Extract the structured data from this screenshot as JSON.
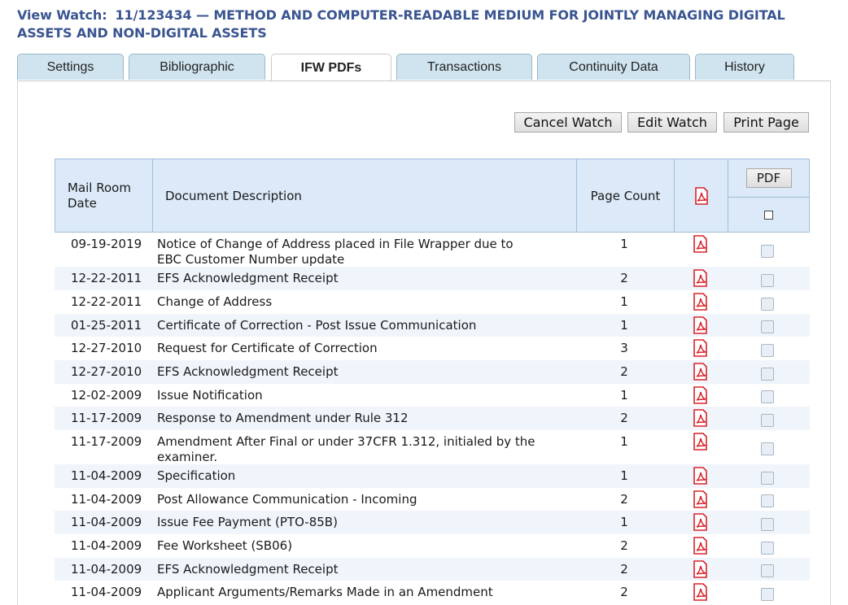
{
  "header": {
    "label": "View Watch:",
    "title": "11/123434 — METHOD AND COMPUTER-READABLE MEDIUM FOR JOINTLY MANAGING DIGITAL ASSETS AND NON-DIGITAL ASSETS"
  },
  "tabs": [
    {
      "label": "Settings"
    },
    {
      "label": "Bibliographic"
    },
    {
      "label": "IFW PDFs",
      "active": true
    },
    {
      "label": "Transactions"
    },
    {
      "label": "Continuity Data"
    },
    {
      "label": "History"
    }
  ],
  "actions": {
    "cancel": "Cancel Watch",
    "edit": "Edit Watch",
    "print": "Print Page"
  },
  "table": {
    "headers": {
      "date": "Mail Room Date",
      "description": "Document Description",
      "page_count": "Page Count",
      "pdf_button": "PDF"
    },
    "rows": [
      {
        "date": "09-19-2019",
        "description": "Notice of Change of Address placed in File Wrapper due to EBC Customer Number update",
        "pages": "1"
      },
      {
        "date": "12-22-2011",
        "description": "EFS Acknowledgment Receipt",
        "pages": "2"
      },
      {
        "date": "12-22-2011",
        "description": "Change of Address",
        "pages": "1"
      },
      {
        "date": "01-25-2011",
        "description": "Certificate of Correction - Post Issue Communication",
        "pages": "1"
      },
      {
        "date": "12-27-2010",
        "description": "Request for Certificate of Correction",
        "pages": "3"
      },
      {
        "date": "12-27-2010",
        "description": "EFS Acknowledgment Receipt",
        "pages": "2"
      },
      {
        "date": "12-02-2009",
        "description": "Issue Notification",
        "pages": "1"
      },
      {
        "date": "11-17-2009",
        "description": "Response to Amendment under Rule 312",
        "pages": "2"
      },
      {
        "date": "11-17-2009",
        "description": "Amendment After Final or under 37CFR 1.312, initialed by the examiner.",
        "pages": "1"
      },
      {
        "date": "11-04-2009",
        "description": "Specification",
        "pages": "1"
      },
      {
        "date": "11-04-2009",
        "description": "Post Allowance Communication - Incoming",
        "pages": "2"
      },
      {
        "date": "11-04-2009",
        "description": "Issue Fee Payment (PTO-85B)",
        "pages": "1"
      },
      {
        "date": "11-04-2009",
        "description": "Fee Worksheet (SB06)",
        "pages": "2"
      },
      {
        "date": "11-04-2009",
        "description": "EFS Acknowledgment Receipt",
        "pages": "2"
      },
      {
        "date": "11-04-2009",
        "description": "Applicant Arguments/Remarks Made in an Amendment",
        "pages": "2"
      }
    ]
  },
  "colors": {
    "title": "#3a5590",
    "tab_bg": "#cfe4ef",
    "header_bg": "#dbe9f8",
    "row_alt": "#f0f5fb",
    "pdf_icon": "#d8232a"
  },
  "icons": {
    "pdf": "pdf-icon"
  }
}
